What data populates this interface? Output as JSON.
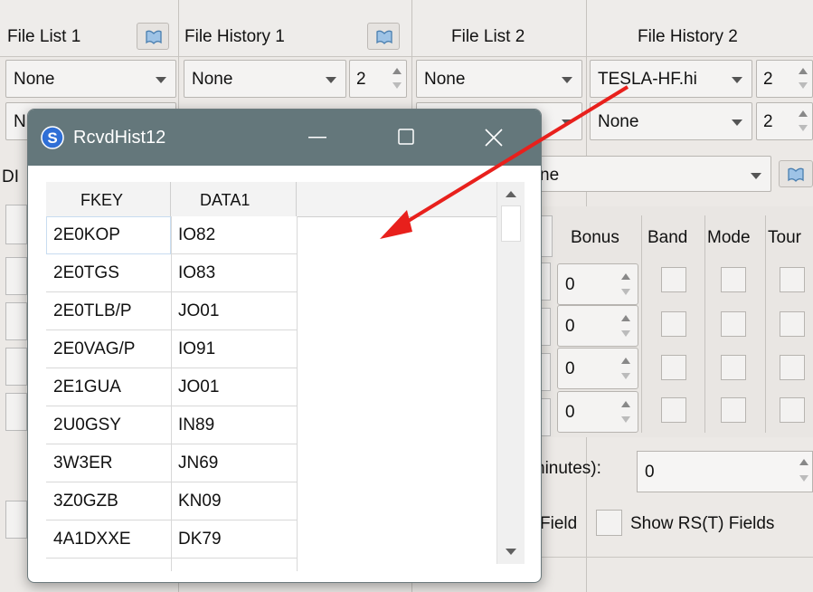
{
  "header": {
    "file_list_1": "File List 1",
    "file_history_1": "File History 1",
    "file_list_2": "File List 2",
    "file_history_2": "File History 2"
  },
  "combos": {
    "fl1_row1": "None",
    "fh1_row1": "None",
    "fh1_spin1": "2",
    "fl2_row1": "None",
    "fh2_row1": "TESLA-HF.hi",
    "fh2_spin1": "2",
    "fl1_row2_partial": "N",
    "fh2_row2": "None",
    "fh2_spin2": "2",
    "partial_left_row3": "DI",
    "partial_combo_row3": "ne"
  },
  "columns": {
    "bonus": "Bonus",
    "band": "Band",
    "mode": "Mode",
    "tour_partial": "Tour"
  },
  "bonus_values": [
    "0",
    "0",
    "0",
    "0"
  ],
  "minutes": {
    "label": "ninutes):",
    "value": "0"
  },
  "fields": {
    "partial_field": "Field",
    "show_rst": "Show RS(T) Fields"
  },
  "popup": {
    "title": "RcvdHist12",
    "columns": [
      "FKEY",
      "DATA1"
    ],
    "rows": [
      {
        "fkey": "2E0KOP",
        "data1": "IO82"
      },
      {
        "fkey": "2E0TGS",
        "data1": "IO83"
      },
      {
        "fkey": "2E0TLB/P",
        "data1": "JO01"
      },
      {
        "fkey": "2E0VAG/P",
        "data1": "IO91"
      },
      {
        "fkey": "2E1GUA",
        "data1": "JO01"
      },
      {
        "fkey": "2U0GSY",
        "data1": "IN89"
      },
      {
        "fkey": "3W3ER",
        "data1": "JN69"
      },
      {
        "fkey": "3Z0GZB",
        "data1": "KN09"
      },
      {
        "fkey": "4A1DXXE",
        "data1": "DK79"
      }
    ]
  },
  "colors": {
    "titlebar": "#64777b",
    "arrow": "#e8201c"
  }
}
